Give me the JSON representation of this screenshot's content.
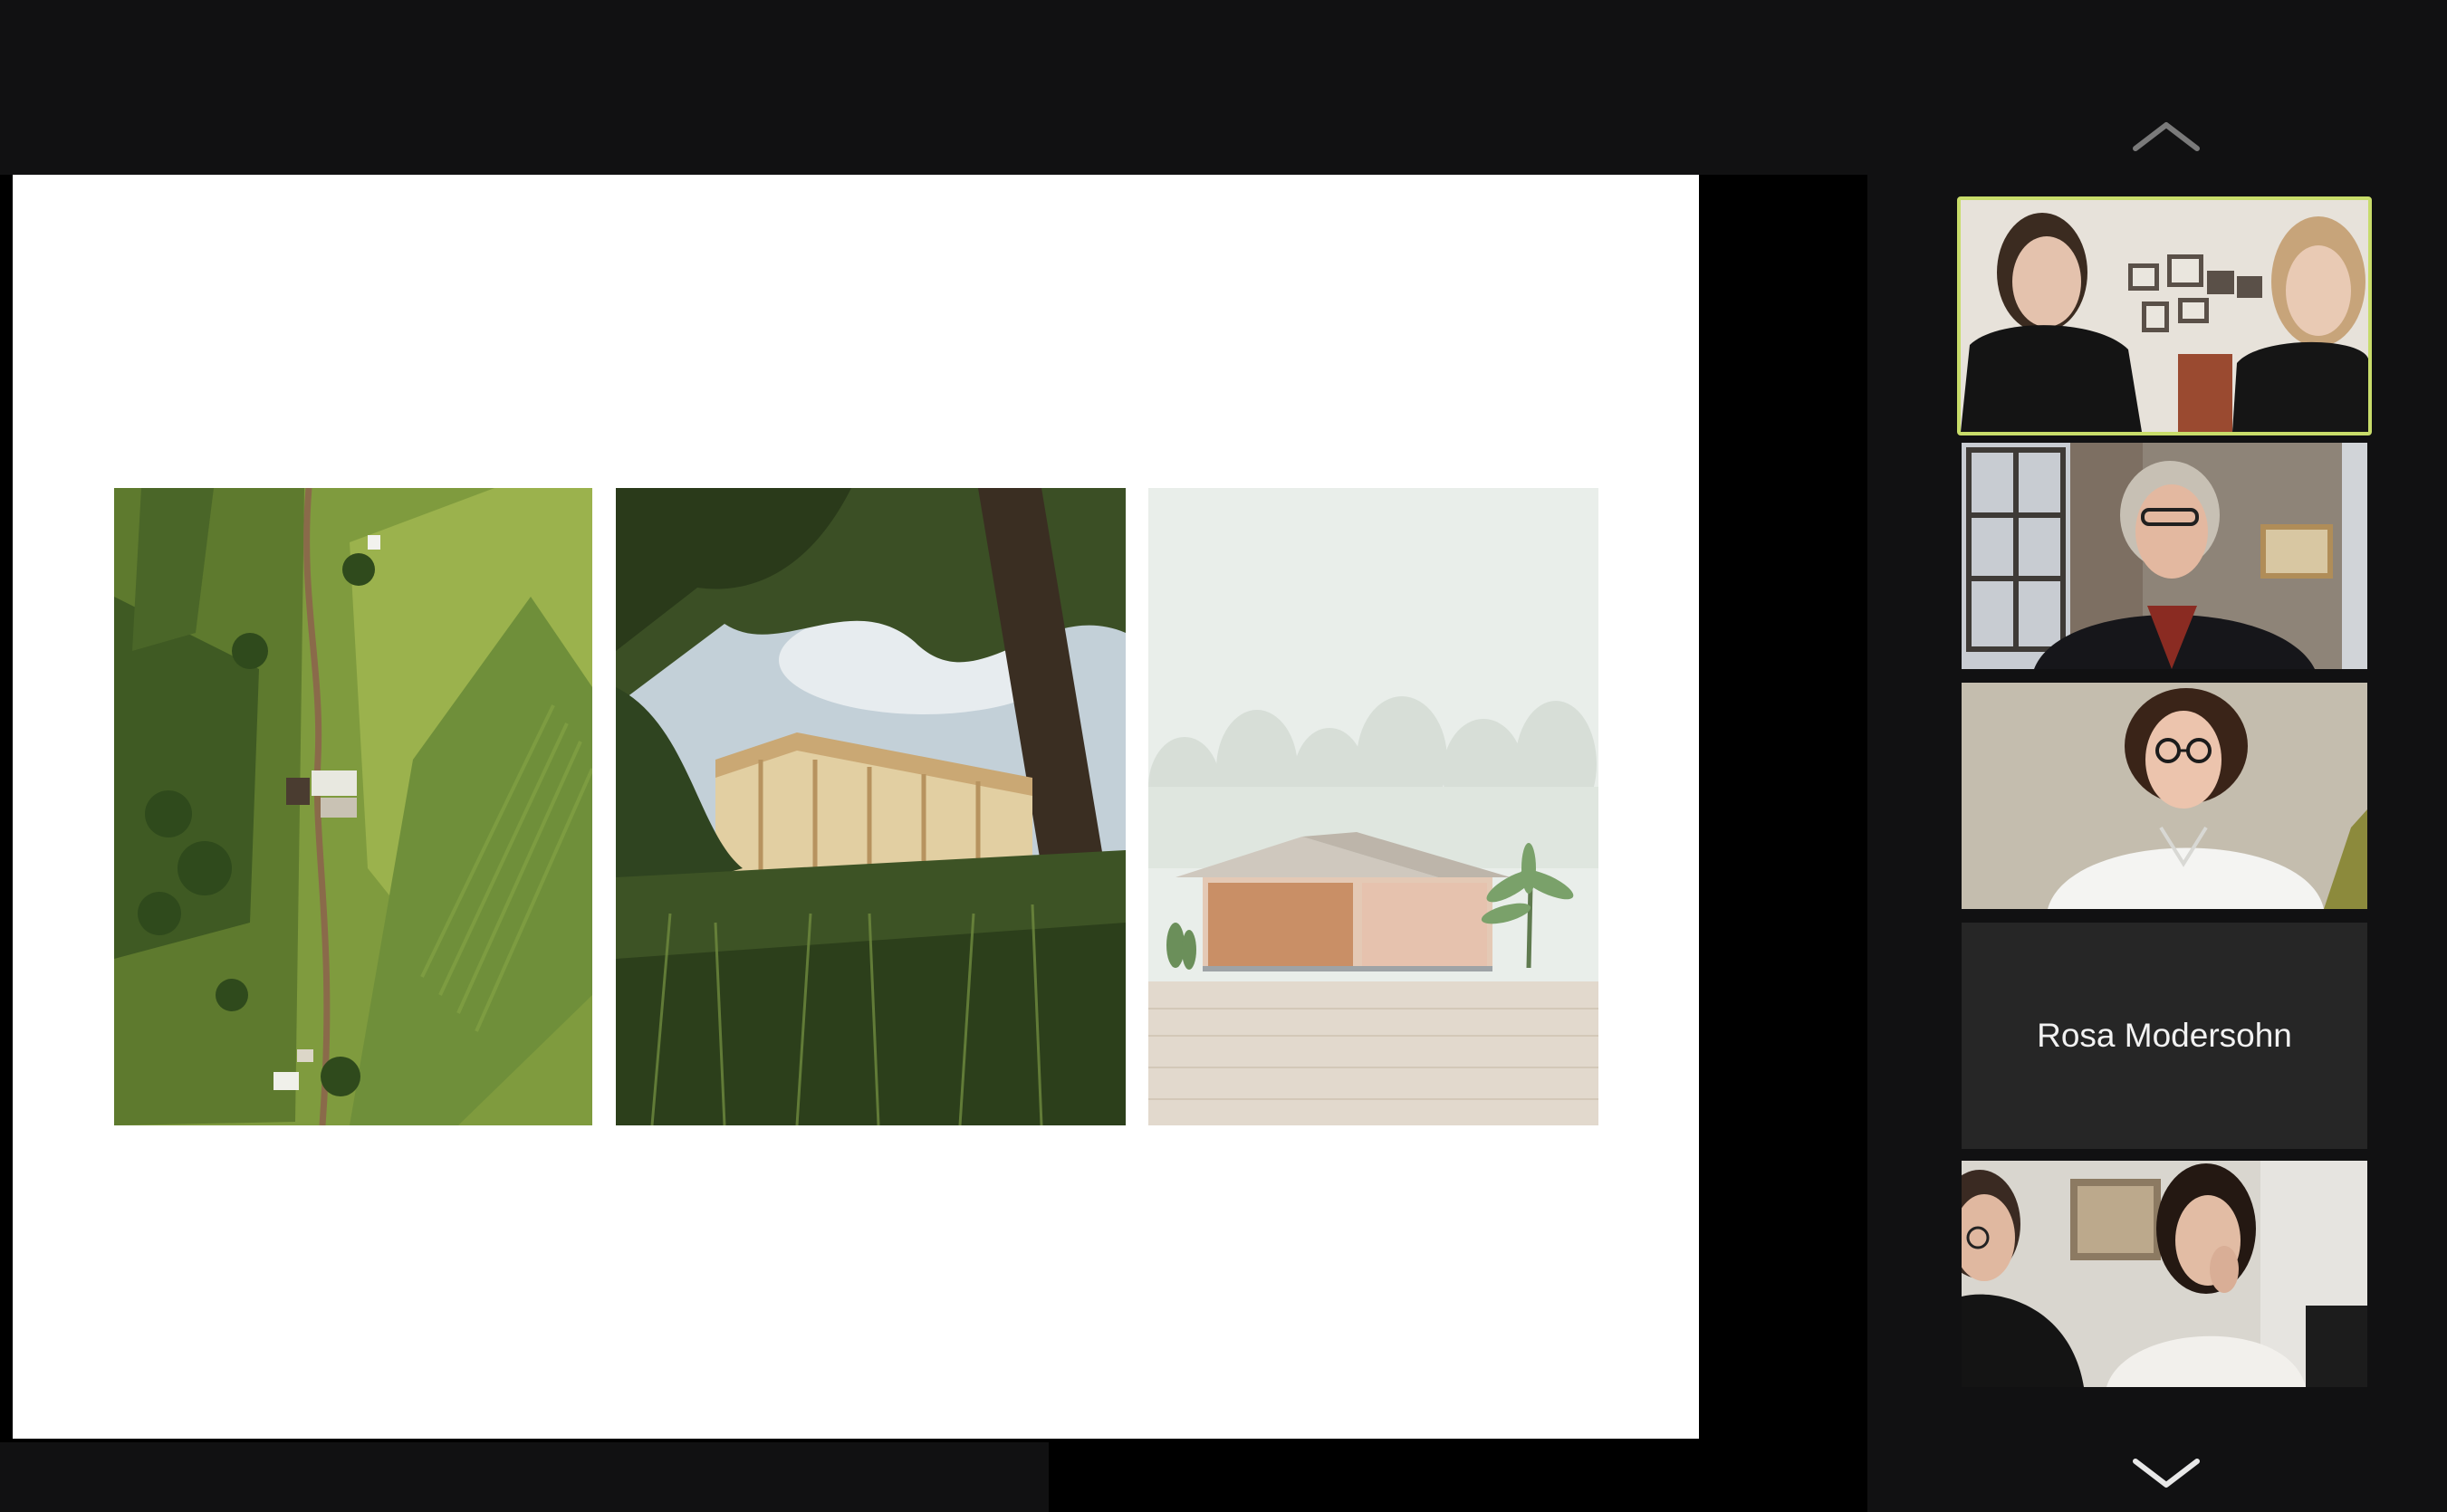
{
  "presentation": {
    "images": [
      {
        "name": "aerial-landscape-photo"
      },
      {
        "name": "timber-structure-photo"
      },
      {
        "name": "building-elevation-render"
      }
    ]
  },
  "gallery": {
    "participants": [
      {
        "id": "p1",
        "active": true,
        "video": true
      },
      {
        "id": "p2",
        "active": false,
        "video": true
      },
      {
        "id": "p3",
        "active": false,
        "video": true
      },
      {
        "id": "p4",
        "active": false,
        "video": false,
        "name": "Rosa Modersohn"
      },
      {
        "id": "p5",
        "active": false,
        "video": true
      }
    ],
    "scroll_up_icon": "chevron-up-icon",
    "scroll_down_icon": "chevron-down-icon",
    "active_speaker_color": "#c8dc6a"
  },
  "colors": {
    "background": "#111112",
    "slide": "#ffffff",
    "name_tile": "#262626"
  }
}
